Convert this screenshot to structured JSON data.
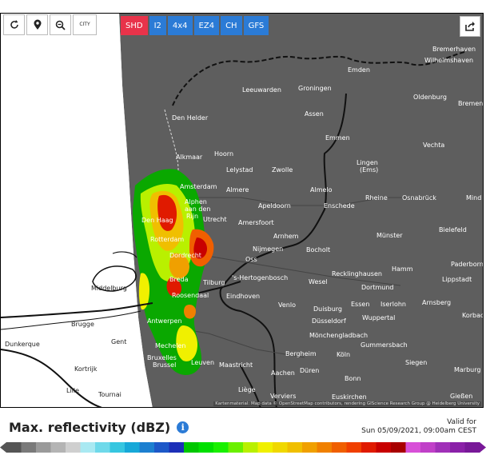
{
  "toolbar": {
    "refresh_icon": "refresh-icon",
    "locate_icon": "location-pin-icon",
    "zoom_out_icon": "zoom-out-icon",
    "city_label": "CITY"
  },
  "models": [
    {
      "label": "SHD",
      "active": true
    },
    {
      "label": "I2",
      "active": false
    },
    {
      "label": "4x4",
      "active": false
    },
    {
      "label": "EZ4",
      "active": false
    },
    {
      "label": "CH",
      "active": false
    },
    {
      "label": "GFS",
      "active": false
    }
  ],
  "share_icon": "share-icon",
  "map": {
    "cities": {
      "bremerhaven": "Bremerhaven",
      "wilhelmshaven": "Wilhelmshaven",
      "emden": "Emden",
      "leeuwarden": "Leeuwarden",
      "groningen": "Groningen",
      "oldenburg": "Oldenburg",
      "bremen": "Bremen",
      "assen": "Assen",
      "den_helder": "Den Helder",
      "emmen": "Emmen",
      "vechta": "Vechta",
      "alkmaar": "Alkmaar",
      "hoorn": "Hoorn",
      "lelystad": "Lelystad",
      "zwolle": "Zwolle",
      "lingen": "Lingen",
      "lingen_ems": "(Ems)",
      "amsterdam": "Amsterdam",
      "almere": "Almere",
      "almelo": "Almelo",
      "alphen_1": "Alphen",
      "alphen_2": "aan den",
      "alphen_3": "Rijn",
      "apeldoorn": "Apeldoorn",
      "rheine": "Rheine",
      "osnabruck": "Osnabrück",
      "minden": "Mind",
      "den_haag": "Den Haag",
      "utrecht": "Utrecht",
      "enschede": "Enschede",
      "amersfoort": "Amersfoort",
      "bielefeld": "Bielefeld",
      "rotterdam": "Rotterdam",
      "arnhem": "Arnhem",
      "munster": "Münster",
      "nijmegen": "Nijmegen",
      "bocholt": "Bocholt",
      "dordrecht": "Dordrecht",
      "oss": "Oss",
      "hamm": "Hamm",
      "paderborn": "Paderborn",
      "breda": "Breda",
      "s_hertogenbosch": "'s-Hertogenbosch",
      "recklinghausen": "Recklinghausen",
      "wesel": "Wesel",
      "lippstadt": "Lippstadt",
      "middelburg": "Middelburg",
      "tilburg": "Tilburg",
      "dortmund": "Dortmund",
      "roosendaal": "Roosendaal",
      "eindhoven": "Eindhoven",
      "venlo": "Venlo",
      "essen": "Essen",
      "iserlohn": "Iserlohn",
      "arnsberg": "Arnsberg",
      "duisburg": "Duisburg",
      "brugge": "Brugge",
      "antwerpen": "Antwerpen",
      "wuppertal": "Wuppertal",
      "dusseldorf": "Düsseldorf",
      "korbach": "Korbac",
      "monchengladbach": "Mönchengladbach",
      "dunkerque": "Dunkerque",
      "gent": "Gent",
      "mechelen": "Mechelen",
      "gummersbach": "Gummersbach",
      "bergheim": "Bergheim",
      "koln": "Köln",
      "bruxelles_1": "Bruxelles",
      "bruxelles_2": "Brussel",
      "leuven": "Leuven",
      "maastricht": "Maastricht",
      "siegen": "Siegen",
      "kortrijk": "Kortrijk",
      "aachen": "Aachen",
      "duren": "Düren",
      "marburg": "Marburg",
      "bonn": "Bonn",
      "lille": "Lille",
      "tournai": "Tournai",
      "liege": "Liège",
      "verviers": "Verviers",
      "euskirchen": "Euskirchen",
      "giessen": "Gießen"
    },
    "attribution": "Kartenmaterial: Map data © OpenStreetMap contributors, rendering GIScience Research Group @ Heidelberg University"
  },
  "legend": {
    "title": "Max. reflectivity (dBZ)",
    "info_icon": "info-icon",
    "valid_label": "Valid for",
    "valid_time": "Sun 05/09/2021, 09:00am CEST",
    "scale_colors": [
      "#555555",
      "#7a7a7a",
      "#9a9a9a",
      "#b4b4b4",
      "#cfcfcf",
      "#a9e9f2",
      "#6fd9ea",
      "#36c6e0",
      "#17a8d8",
      "#1c7fd0",
      "#1d58c8",
      "#1c2fb8",
      "#00c700",
      "#00e000",
      "#19f000",
      "#6af000",
      "#b9f000",
      "#f0f000",
      "#f0d800",
      "#f0bf00",
      "#f0a000",
      "#f08000",
      "#f05f00",
      "#f03f00",
      "#e01a00",
      "#c80000",
      "#a80000",
      "#d850d8",
      "#c040c8",
      "#a030b8",
      "#8a20a8",
      "#781898"
    ]
  }
}
